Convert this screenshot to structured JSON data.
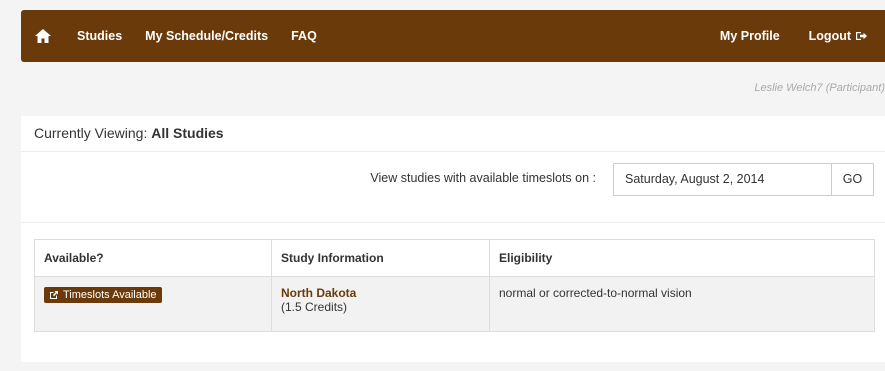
{
  "nav": {
    "home_icon": "home-icon",
    "links": [
      "Studies",
      "My Schedule/Credits",
      "FAQ"
    ],
    "profile": "My Profile",
    "logout": "Logout",
    "logout_icon": "logout-icon",
    "bar_color": "#6b3a0a"
  },
  "user": "Leslie Welch7 (Participant)",
  "panel": {
    "heading_prefix": "Currently Viewing:",
    "heading_value": "All Studies"
  },
  "filter": {
    "label": "View studies with available timeslots on :",
    "date": "Saturday, August 2, 2014",
    "go": "GO"
  },
  "table": {
    "headers": [
      "Available?",
      "Study Information",
      "Eligibility"
    ],
    "rows": [
      {
        "available": "Timeslots Available",
        "study_name": "North Dakota",
        "credits": "(1.5 Credits)",
        "eligibility": "normal or corrected-to-normal vision"
      }
    ]
  }
}
